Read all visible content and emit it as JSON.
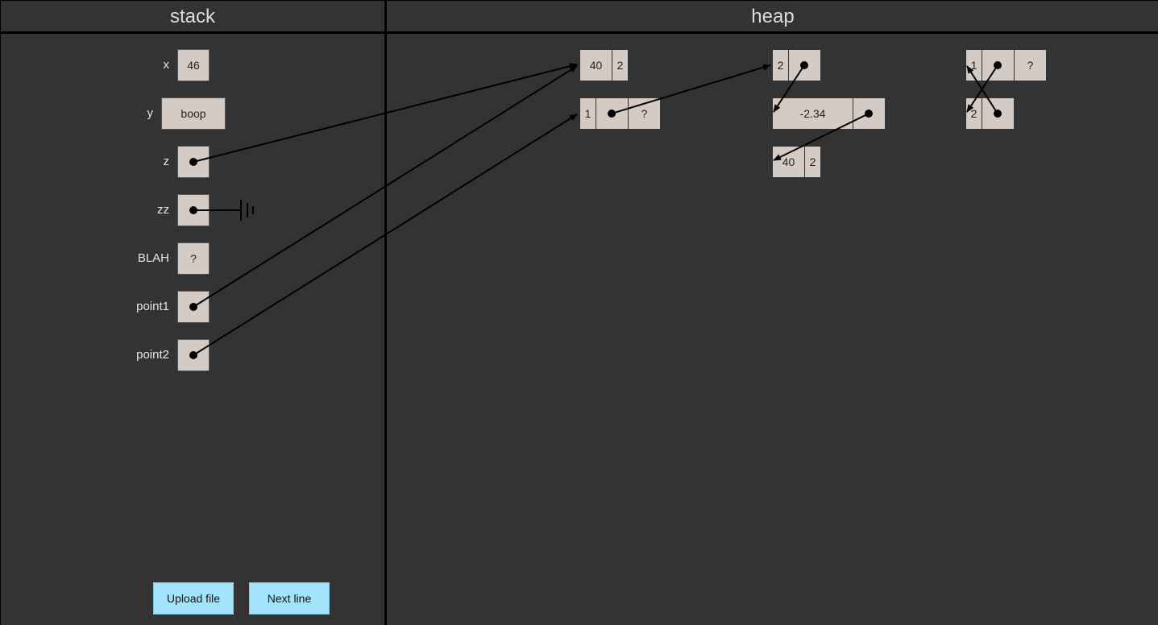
{
  "panels": {
    "stack_title": "stack",
    "heap_title": "heap"
  },
  "stack": {
    "x": {
      "label": "x",
      "value": "46"
    },
    "y": {
      "label": "y",
      "value": "boop"
    },
    "z": {
      "label": "z"
    },
    "zz": {
      "label": "zz"
    },
    "blah": {
      "label": "BLAH",
      "value": "?"
    },
    "point1": {
      "label": "point1"
    },
    "point2": {
      "label": "point2"
    }
  },
  "heap": {
    "a": [
      "40",
      "2"
    ],
    "b": [
      "1",
      "?"
    ],
    "c": [
      "2"
    ],
    "d": [
      "-2.34"
    ],
    "e": [
      "40",
      "2"
    ],
    "f": [
      "1",
      "?"
    ],
    "g": [
      "2"
    ]
  },
  "buttons": {
    "upload": "Upload file",
    "next": "Next line"
  },
  "colors": {
    "background": "#333333",
    "cell": "#d3cbc4",
    "button": "#a3e3fb",
    "arrow": "#000000"
  }
}
